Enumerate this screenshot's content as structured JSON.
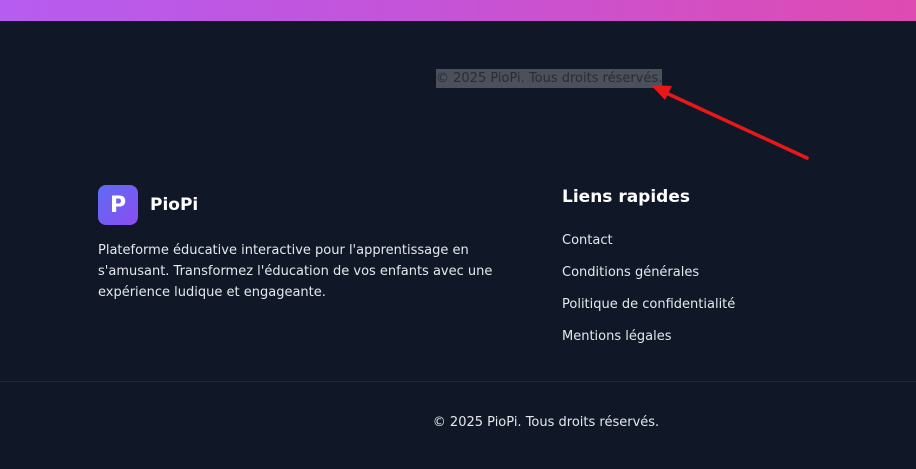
{
  "header": {
    "accent_gradient": [
      "#b65cf0",
      "#de4bb1"
    ]
  },
  "selection": {
    "text": "© 2025 PioPi. Tous droits réservés."
  },
  "annotation": {
    "arrow_color": "#e81818"
  },
  "brand": {
    "logo_letter": "P",
    "name": "PioPi",
    "description": "Plateforme éducative interactive pour l'apprentissage en s'amusant. Transformez l'éducation de vos enfants avec une expérience ludique et engageante."
  },
  "quick_links": {
    "title": "Liens rapides",
    "items": [
      {
        "label": "Contact"
      },
      {
        "label": "Conditions générales"
      },
      {
        "label": "Politique de confidentialité"
      },
      {
        "label": "Mentions légales"
      }
    ]
  },
  "footer": {
    "copyright": "© 2025 PioPi. Tous droits réservés."
  },
  "colors": {
    "background": "#101828",
    "logo_gradient": [
      "#5f6cf4",
      "#8a4df0"
    ]
  }
}
